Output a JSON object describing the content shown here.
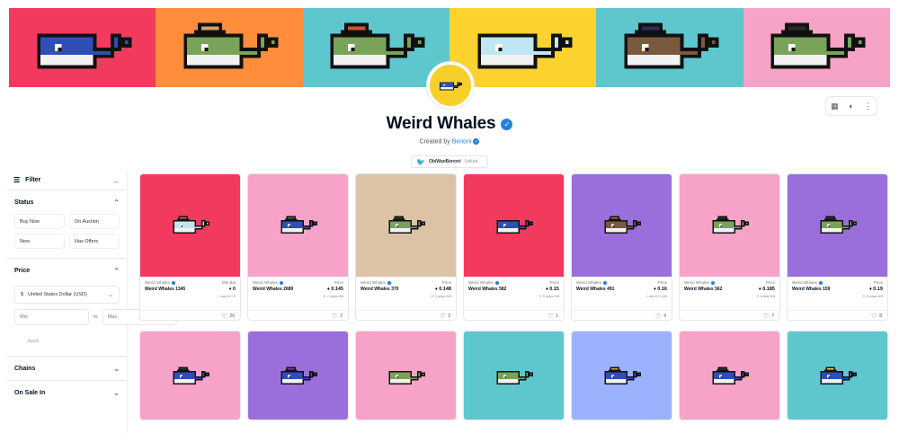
{
  "banner": {
    "tiles": [
      {
        "bg": "#f23a5f",
        "whale": "#2f4fb6",
        "hat": "none"
      },
      {
        "bg": "#ff8d3c",
        "whale": "#7aa35a",
        "hat": "propeller"
      },
      {
        "bg": "#5ec7ce",
        "whale": "#7aa35a",
        "hat": "beanie"
      },
      {
        "bg": "#fbd22e",
        "whale": "#bfe6f2",
        "hat": "none"
      },
      {
        "bg": "#5ec7ce",
        "whale": "#7a5a3f",
        "hat": "cap"
      },
      {
        "bg": "#f5a3c6",
        "whale": "#7aa35a",
        "hat": "bowler"
      }
    ]
  },
  "avatar": {
    "bg": "#f7cf2a",
    "whale": "#2f4fb6"
  },
  "icons": {
    "grid": "grid-icon",
    "discord": "discord-icon",
    "more": "more-icon"
  },
  "collection": {
    "title": "Weird Whales",
    "verified_mark": "✓",
    "created_prefix": "Created by",
    "creator": "Benoni",
    "twitter_handle": "ObiWanBenoni",
    "twitter_status": "Linked"
  },
  "sidebar": {
    "filter_label": "Filter",
    "status_label": "Status",
    "status_options": [
      "Buy Now",
      "On Auction",
      "New",
      "Has Offers"
    ],
    "price_label": "Price",
    "currency": "United States Dollar (USD)",
    "currency_symbol": "$",
    "min_placeholder": "Min",
    "to_label": "to",
    "max_placeholder": "Max",
    "apply_label": "Apply",
    "chains_label": "Chains",
    "on_sale_label": "On Sale In"
  },
  "cards": [
    {
      "bg": "#f23a5f",
      "whale": "#bfe6f2",
      "hat": "#c9703a",
      "collection": "Weird Whales",
      "name": "Weird Whales 1345",
      "price_label": "Min Bid",
      "price": "♦ 0",
      "sub": "Last ♦ 0.5",
      "likes": "26"
    },
    {
      "bg": "#f7a3c9",
      "whale": "#2f4fb6",
      "hat": "#3a7a3a",
      "collection": "Weird Whales",
      "name": "Weird Whales 2689",
      "price_label": "Price",
      "price": "♦ 0.145",
      "sub": "⊙ 2 days left",
      "likes": "2"
    },
    {
      "bg": "#ddc3a6",
      "whale": "#7aa35a",
      "hat": "#333333",
      "collection": "Weird Whales",
      "name": "Weird Whales 370",
      "price_label": "Price",
      "price": "♦ 0.148",
      "sub": "⊙ 2 days left",
      "likes": "3"
    },
    {
      "bg": "#f23a5f",
      "whale": "#2f4fb6",
      "hat": "none",
      "collection": "Weird Whales",
      "name": "Weird Whales 582",
      "price_label": "Price",
      "price": "♦ 0.15",
      "sub": "⊙ 5 days left",
      "likes": "1"
    },
    {
      "bg": "#9a6fdc",
      "whale": "#7a5a3f",
      "hat": "#c9703a",
      "collection": "Weird Whales",
      "name": "Weird Whales 491",
      "price_label": "Price",
      "price": "♦ 0.16",
      "sub": "Last ♦ 0.185",
      "likes": "4"
    },
    {
      "bg": "#f7a3c9",
      "whale": "#7aa35a",
      "hat": "#333333",
      "collection": "Weird Whales",
      "name": "Weird Whales 562",
      "price_label": "Price",
      "price": "♦ 0.185",
      "sub": "⊙ a day left",
      "likes": "7"
    },
    {
      "bg": "#9a6fdc",
      "whale": "#7aa35a",
      "hat": "#333333",
      "collection": "Weird Whales",
      "name": "Weird Whales 159",
      "price_label": "Price",
      "price": "♦ 0.19",
      "sub": "⊙ 6 days left",
      "likes": "8"
    },
    {
      "bg": "#f7a3c9",
      "whale": "#2f4fb6",
      "hat": "#333333"
    },
    {
      "bg": "#9a6fdc",
      "whale": "#2f4fb6",
      "hat": "#7b3fc4"
    },
    {
      "bg": "#f7a3c9",
      "whale": "#7aa35a",
      "hat": "none"
    },
    {
      "bg": "#5ec7ce",
      "whale": "#7aa35a",
      "hat": "none"
    },
    {
      "bg": "#9cb2ff",
      "whale": "#2f4fb6",
      "hat": "#e0b030"
    },
    {
      "bg": "#f7a3c9",
      "whale": "#2f4fb6",
      "hat": "#333333"
    },
    {
      "bg": "#5ec7ce",
      "whale": "#2f4fb6",
      "hat": "#f5e23a"
    }
  ]
}
